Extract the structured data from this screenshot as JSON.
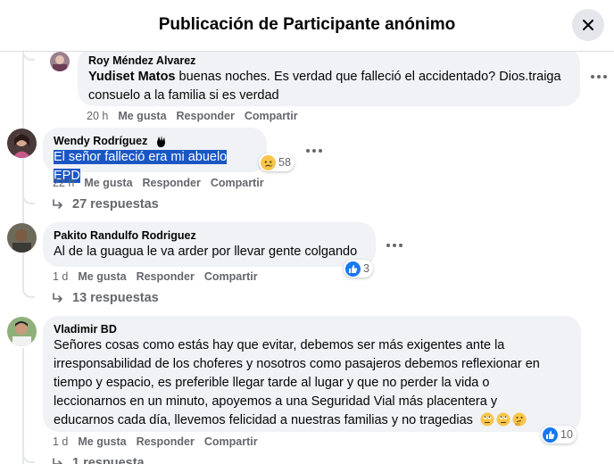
{
  "header": {
    "title": "Publicación de Participante anónimo"
  },
  "actions": {
    "like": "Me gusta",
    "reply": "Responder",
    "share": "Compartir"
  },
  "comments": [
    {
      "author": "Roy Méndez Alvarez",
      "mention": "Yudiset Matos",
      "text_line1": " buenas noches. Es verdad que falleció el accidentado? Dios.traiga",
      "text_line2": "consuelo a la familia si es verdad",
      "time": "20 h"
    },
    {
      "author": "Wendy Rodríguez",
      "text": "El señor falleció era mi abuelo EPD",
      "time": "22 h",
      "reaction_count": "58",
      "replies": "27 respuestas"
    },
    {
      "author": "Pakito Randulfo Rodriguez",
      "text": "Al de la guagua le va arder por llevar gente colgando",
      "time": "1 d",
      "reaction_count": "3",
      "replies": "13 respuestas"
    },
    {
      "author": "Vladimir BD",
      "lines": [
        "Señores cosas como estás hay que evitar, debemos ser más exigentes ante la",
        "irresponsabilidad de los choferes y nosotros como pasajeros debemos reflexionar en",
        "tiempo y espacio, es preferible llegar tarde al lugar y que no perder la vida o",
        "leccionarnos en un minuto, apoyemos a una Seguridad Vial más placentera y",
        "educarnos cada día, llevemos felicidad a nuestras familias y no tragedias"
      ],
      "time": "1 d",
      "reaction_count": "10",
      "replies": "1 respuesta"
    }
  ]
}
